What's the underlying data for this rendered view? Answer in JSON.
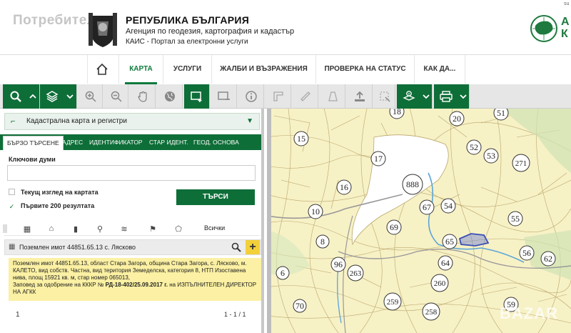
{
  "watermark": "Потребител",
  "header": {
    "republic": "РЕПУБЛИКА БЪЛГАРИЯ",
    "agency": "Агенция по геодезия, картография и кадастър",
    "portal": "КАИС - Портал за електронни услуги",
    "logo_text_1": "А",
    "logo_text_2": "К",
    "corner": "su"
  },
  "nav": {
    "items": [
      "КАРТА",
      "УСЛУГИ",
      "ЖАЛБИ И ВЪЗРАЖЕНИЯ",
      "ПРОВЕРКА НА СТАТУС",
      "КАК ДА..."
    ],
    "active": "КАРТА"
  },
  "toolbar": {
    "icons": [
      "search-icon",
      "chevron-up-icon",
      "layers-icon",
      "chevron-down-icon",
      "zoom-in-icon",
      "zoom-out-icon",
      "pan-hand-icon",
      "globe-icon",
      "select-area-icon",
      "select-rect-icon",
      "info-icon",
      "measure-icon",
      "ruler-icon",
      "polygon-icon",
      "upload-icon",
      "crop-icon",
      "layer-info-icon",
      "print-icon"
    ]
  },
  "panel": {
    "layer_select": "Кадастрална карта и регистри",
    "tabs": [
      "БЪРЗО ТЪРСЕНЕ",
      "АДРЕС",
      "ИДЕНТИФИКАТОР",
      "СТАР ИДЕНТ.",
      "ГЕОД. ОСНОВА"
    ],
    "active_tab": "БЪРЗО ТЪРСЕНЕ",
    "keywords_label": "Ключови думи",
    "keywords_value": "",
    "current_view_label": "Текущ изглед на картата",
    "first_200_label": "Първите 200 резултата",
    "search_button": "ТЪРСИ",
    "all_label": "Всички",
    "result_title": "Поземлен имот 44851.65.13 с. Лясково",
    "result_desc": "Поземлен имот 44851.65.13, област Стара Загора, община Стара Загора, с. Лясково, м. КАЛЕТО, вид собств. Частна, вид територия Земеделска, категория 8, НТП Изоставена нива, площ 15921 кв. м, стар номер 065013,",
    "result_order_prefix": "Заповед за одобрение на КККР №",
    "result_order_number": "РД-18-402/25.09.2017 г.",
    "result_order_suffix": "на ИЗПЪЛНИТЕЛЕН ДИРЕКТОР НА АГКК",
    "page": "1",
    "count": "1 - 1 / 1"
  },
  "map": {
    "labels": [
      "18",
      "20",
      "51",
      "52",
      "53",
      "15",
      "17",
      "271",
      "888",
      "16",
      "10",
      "67",
      "54",
      "55",
      "69",
      "8",
      "65",
      "56",
      "62",
      "96",
      "64",
      "6",
      "263",
      "260",
      "70",
      "259",
      "258",
      "59"
    ]
  },
  "bazar_watermark": "BAZAR",
  "colors": {
    "brand_green": "#0e6e38",
    "highlight": "#fbf0a3",
    "map_fill": "#f7f1c6",
    "selected_parcel": "#3a4fb5"
  }
}
